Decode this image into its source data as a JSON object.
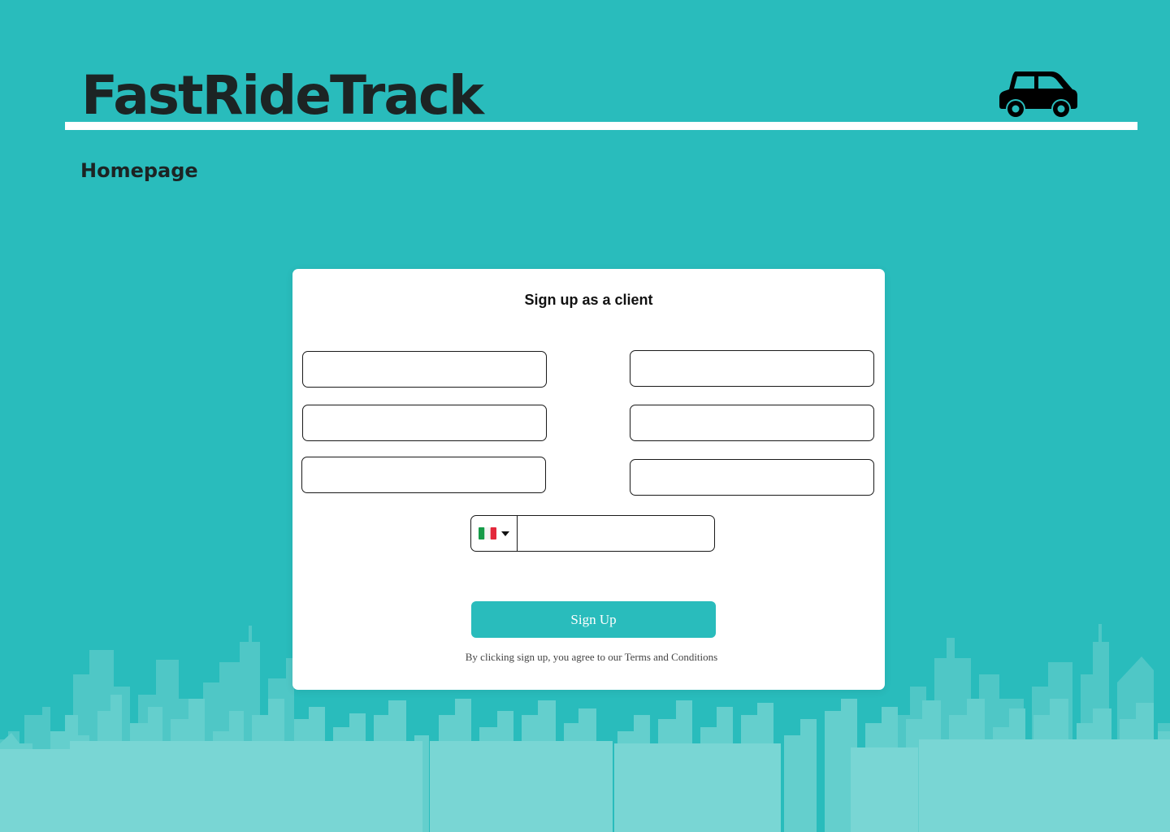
{
  "app": {
    "title": "FastRideTrack",
    "page_title": "Homepage",
    "header_icon": "car-icon"
  },
  "signup": {
    "title": "Sign up as a client",
    "fields": [
      {
        "value": "",
        "placeholder": ""
      },
      {
        "value": "",
        "placeholder": ""
      },
      {
        "value": "",
        "placeholder": ""
      },
      {
        "value": "",
        "placeholder": ""
      },
      {
        "value": "",
        "placeholder": ""
      },
      {
        "value": "",
        "placeholder": ""
      }
    ],
    "phone": {
      "country_flag": "italy-flag-icon",
      "value": "",
      "placeholder": ""
    },
    "submit_label": "Sign Up",
    "terms_text": "By clicking sign up, you agree to our Terms and Conditions"
  },
  "colors": {
    "background": "#29bcbc",
    "card": "#ffffff",
    "accent": "#29bcbc",
    "title_text": "#1c2424",
    "skyline_light": "#79d6d4",
    "skyline_mid": "#55c9c8"
  }
}
